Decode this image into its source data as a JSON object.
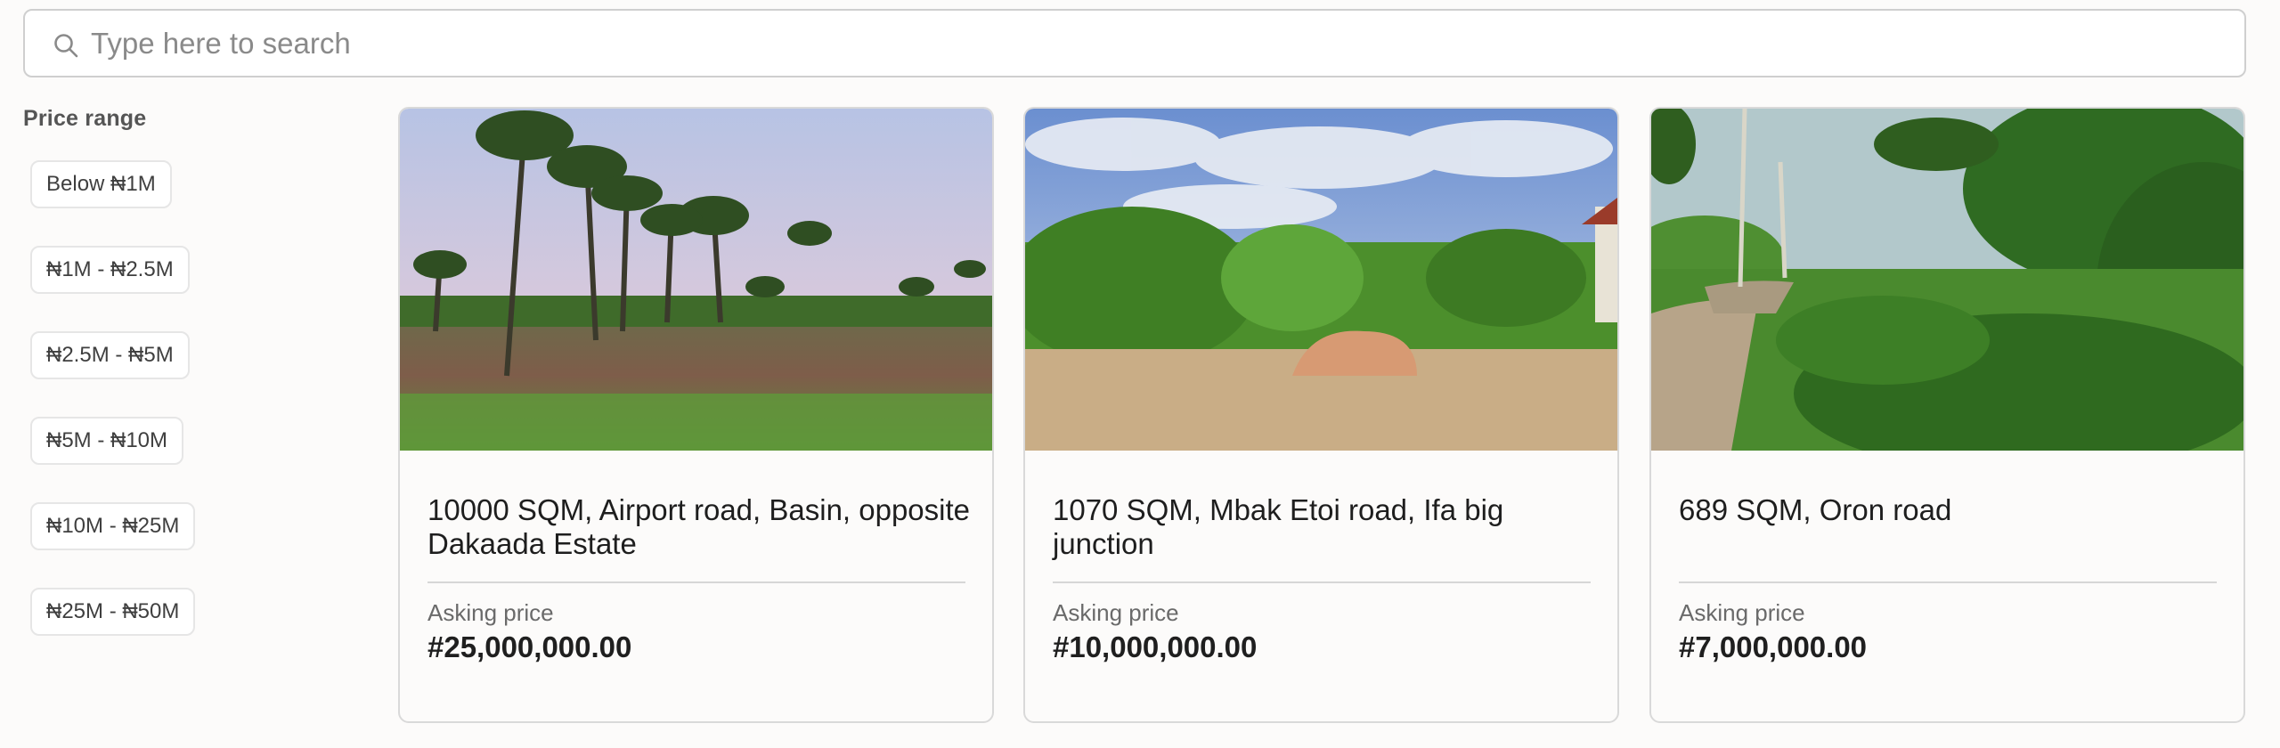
{
  "search": {
    "placeholder": "Type here to search",
    "value": "",
    "icon": "search-icon"
  },
  "filters": {
    "title": "Price range",
    "options": [
      "Below ₦1M",
      "₦1M - ₦2.5M",
      "₦2.5M - ₦5M",
      "₦5M - ₦10M",
      "₦10M - ₦25M",
      "₦25M - ₦50M"
    ]
  },
  "listings": [
    {
      "title": "10000 SQM, Airport road, Basin, opposite Dakaada Estate",
      "price_label": "Asking price",
      "price": "#25,000,000.00"
    },
    {
      "title": "1070 SQM, Mbak Etoi road, Ifa big junction",
      "price_label": "Asking price",
      "price": "#10,000,000.00"
    },
    {
      "title": "689 SQM, Oron road",
      "price_label": "Asking price",
      "price": "#7,000,000.00"
    }
  ],
  "colors": {
    "background": "#fcfbfa",
    "border": "#d9d9d9",
    "text": "#1f1f1f",
    "muted": "#6a6a6a"
  }
}
